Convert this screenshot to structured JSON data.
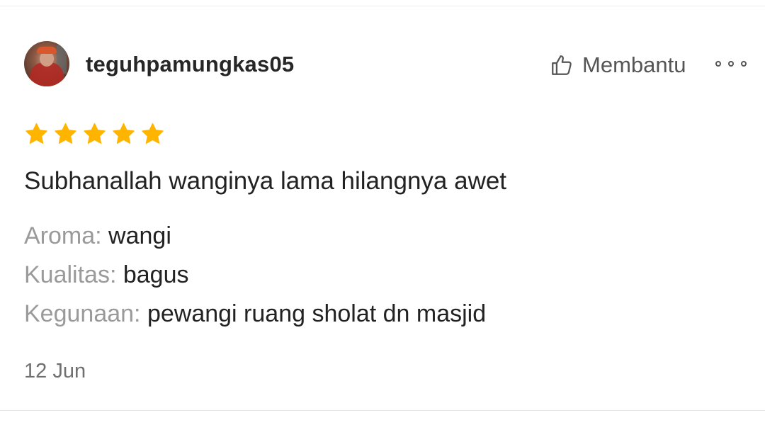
{
  "review": {
    "username": "teguhpamungkas05",
    "helpful_label": "Membantu",
    "rating": 5,
    "rating_max": 5,
    "star_color": "#FFB400",
    "comment": "Subhanallah wanginya lama hilangnya awet",
    "attributes": [
      {
        "key": "Aroma:",
        "value": "wangi"
      },
      {
        "key": "Kualitas:",
        "value": "bagus"
      },
      {
        "key": "Kegunaan:",
        "value": "pewangi ruang sholat dn masjid"
      }
    ],
    "date": "12 Jun",
    "icons": {
      "helpful": "thumbs-up-icon",
      "more": "more-options-icon",
      "star": "star-icon"
    }
  }
}
